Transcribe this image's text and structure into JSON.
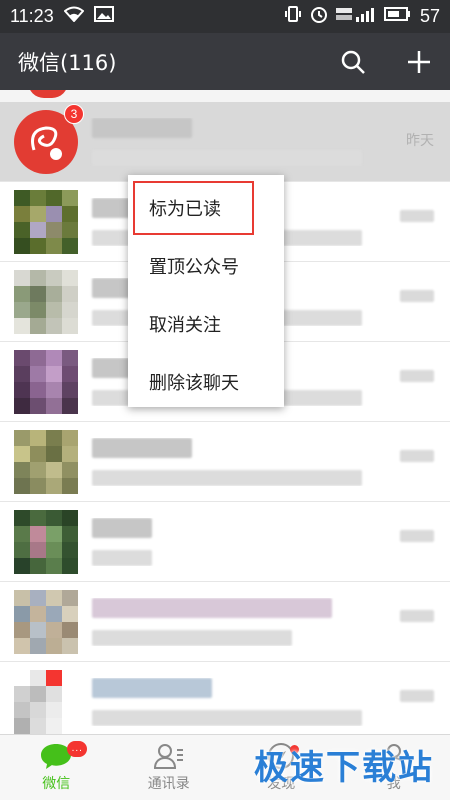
{
  "status_bar": {
    "time": "11:23",
    "battery_level": "57",
    "icons": [
      "wifi-icon",
      "image-icon",
      "vibrate-icon",
      "alarm-icon",
      "signal-icon",
      "battery-icon"
    ]
  },
  "header": {
    "title": "微信(116)",
    "search_icon": "search-icon",
    "add_icon": "plus-icon"
  },
  "chats": [
    {
      "badge": "3",
      "time": "昨天",
      "highlighted": true
    },
    {
      "badge": "",
      "time": "",
      "highlighted": false
    },
    {
      "badge": "",
      "time": "",
      "highlighted": false
    },
    {
      "badge": "",
      "time": "",
      "highlighted": false
    },
    {
      "badge": "",
      "time": "",
      "highlighted": false
    },
    {
      "badge": "",
      "time": "",
      "highlighted": false
    },
    {
      "badge": "",
      "time": "",
      "highlighted": false
    },
    {
      "badge": "",
      "time": "",
      "highlighted": false
    }
  ],
  "context_menu": {
    "items": [
      "标为已读",
      "置顶公众号",
      "取消关注",
      "删除该聊天"
    ],
    "selected_index": 0
  },
  "tabs": [
    {
      "label": "微信",
      "icon": "chat-bubble-icon",
      "active": true,
      "badge": "..."
    },
    {
      "label": "通讯录",
      "icon": "contacts-icon",
      "active": false
    },
    {
      "label": "发现",
      "icon": "compass-icon",
      "active": false,
      "dot": true
    },
    {
      "label": "我",
      "icon": "person-icon",
      "active": false
    }
  ],
  "watermark": "极速下载站",
  "colors": {
    "header_bg": "#393a3f",
    "status_bg": "#2f3033",
    "accent_green": "#45c01a",
    "badge_red": "#f43530",
    "highlight_border": "#e83a32",
    "watermark_blue": "#2a7fd6"
  }
}
